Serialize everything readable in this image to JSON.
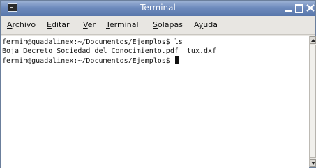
{
  "window": {
    "title": "Terminal"
  },
  "menubar": {
    "items": [
      {
        "accel": "A",
        "rest": "rchivo"
      },
      {
        "accel": "E",
        "rest": "ditar"
      },
      {
        "accel": "V",
        "rest": "er"
      },
      {
        "accel": "T",
        "rest": "erminal"
      },
      {
        "accel": "S",
        "rest": "olapas"
      },
      {
        "pre": "A",
        "accel": "y",
        "rest": "uda"
      }
    ]
  },
  "terminal": {
    "lines": [
      "fermin@guadalinex:~/Documentos/Ejemplos$ ls",
      "Boja Decreto Sociedad del Conocimiento.pdf  tux.dxf",
      "fermin@guadalinex:~/Documentos/Ejemplos$ "
    ]
  },
  "colors": {
    "titlebar": "#6e8bbd",
    "background": "#ffffff"
  },
  "icons": {
    "app": "terminal-icon",
    "minimize": "minimize-icon",
    "maximize": "maximize-icon",
    "close": "close-icon"
  }
}
